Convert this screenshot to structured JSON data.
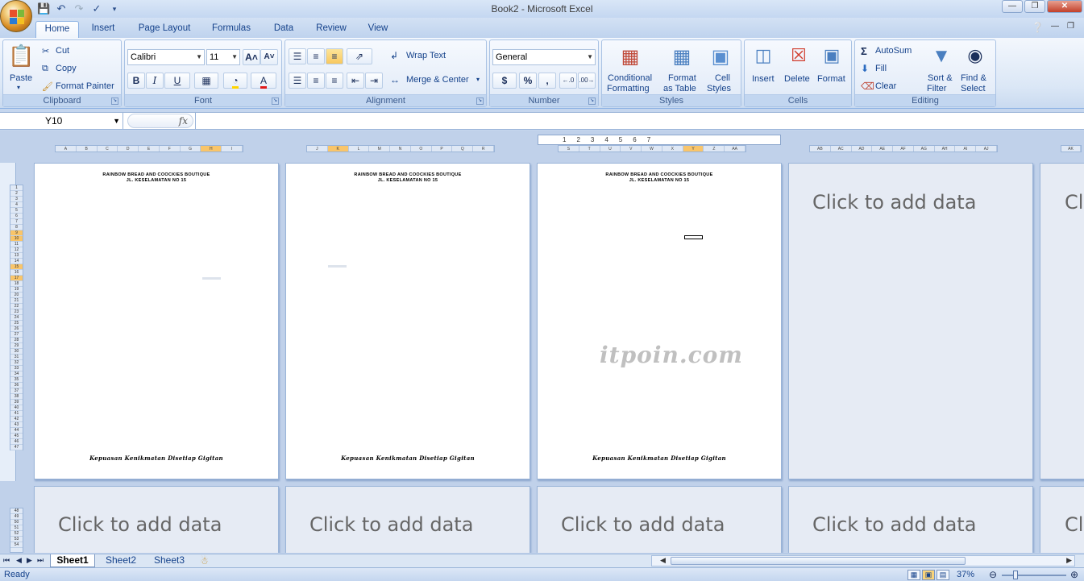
{
  "window": {
    "title": "Book2 - Microsoft Excel"
  },
  "tabs": [
    {
      "label": "Home",
      "active": true
    },
    {
      "label": "Insert"
    },
    {
      "label": "Page Layout"
    },
    {
      "label": "Formulas"
    },
    {
      "label": "Data"
    },
    {
      "label": "Review"
    },
    {
      "label": "View"
    }
  ],
  "ribbon": {
    "clipboard": {
      "label": "Clipboard",
      "paste": "Paste",
      "cut": "Cut",
      "copy": "Copy",
      "format_painter": "Format Painter"
    },
    "font": {
      "label": "Font",
      "name": "Calibri",
      "size": "11",
      "bold": "B",
      "italic": "I",
      "underline": "U"
    },
    "alignment": {
      "label": "Alignment",
      "wrap_text": "Wrap Text",
      "merge_center": "Merge & Center"
    },
    "number": {
      "label": "Number",
      "format": "General",
      "currency": "$",
      "percent": "%",
      "comma": ","
    },
    "styles": {
      "label": "Styles",
      "conditional_1": "Conditional",
      "conditional_2": "Formatting",
      "format_table_1": "Format",
      "format_table_2": "as Table",
      "cell_styles_1": "Cell",
      "cell_styles_2": "Styles"
    },
    "cells": {
      "label": "Cells",
      "insert": "Insert",
      "delete": "Delete",
      "format": "Format"
    },
    "editing": {
      "label": "Editing",
      "autosum": "AutoSum",
      "fill": "Fill",
      "clear": "Clear",
      "sort_1": "Sort &",
      "sort_2": "Filter",
      "find_1": "Find &",
      "find_2": "Select"
    }
  },
  "formula_bar": {
    "name_box": "Y10",
    "fx": "fx",
    "value": ""
  },
  "column_strips": [
    [
      "A",
      "B",
      "C",
      "D",
      "E",
      "F",
      "G",
      "H",
      "I"
    ],
    [
      "J",
      "K",
      "L",
      "M",
      "N",
      "O",
      "P",
      "Q",
      "R"
    ],
    [
      "S",
      "T",
      "U",
      "V",
      "W",
      "X",
      "Y",
      "Z",
      "AA"
    ],
    [
      "AB",
      "AC",
      "AD",
      "AE",
      "AF",
      "AG",
      "AH",
      "AI",
      "AJ"
    ],
    [
      "AK"
    ]
  ],
  "pages": {
    "header_line1": "RAINBOW BREAD AND COOCKIES BOUTIQUE",
    "header_line2": "JL. KESELAMATAN NO 15",
    "footer": "Kepuasan Kenikmatan Disetiap Gigitan",
    "placeholder": "Click to add data",
    "placeholder_cut": "Cli"
  },
  "watermark": "itpoin.com",
  "sheets": [
    {
      "label": "Sheet1",
      "active": true
    },
    {
      "label": "Sheet2"
    },
    {
      "label": "Sheet3"
    }
  ],
  "status": {
    "text": "Ready",
    "zoom": "37%"
  },
  "colors": {
    "accent": "#15428b",
    "ribbon_bg": "#dbe7f6",
    "workspace": "#c0d1ea"
  }
}
